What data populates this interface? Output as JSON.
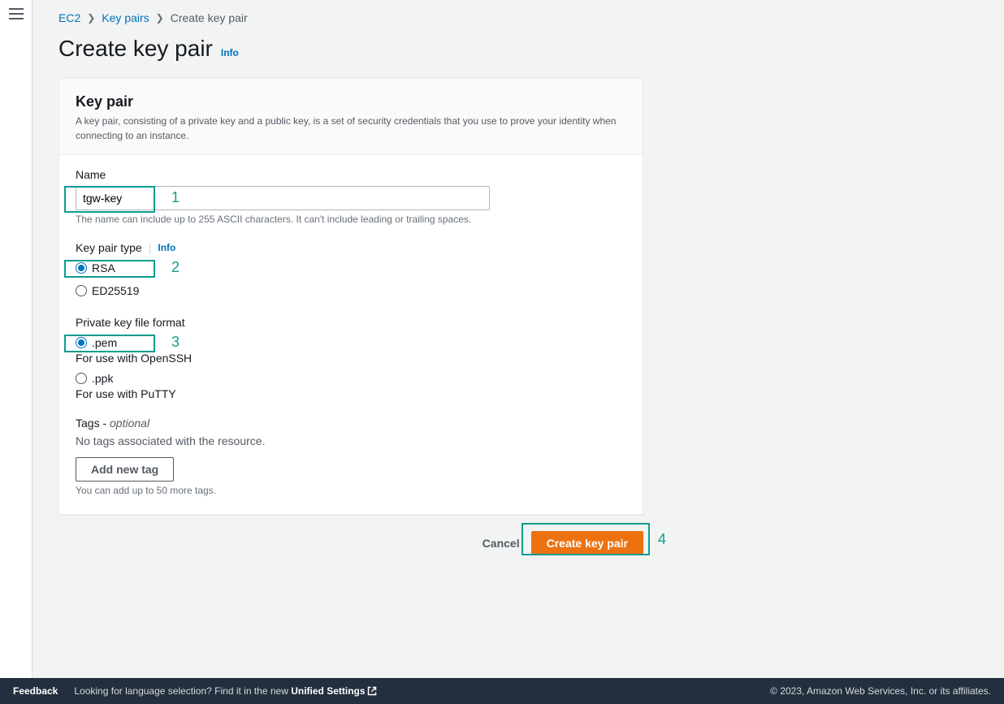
{
  "breadcrumb": {
    "ec2": "EC2",
    "keypairs": "Key pairs",
    "current": "Create key pair"
  },
  "heading": {
    "title": "Create key pair",
    "info": "Info"
  },
  "panel": {
    "title": "Key pair",
    "description": "A key pair, consisting of a private key and a public key, is a set of security credentials that you use to prove your identity when connecting to an instance."
  },
  "form": {
    "name": {
      "label": "Name",
      "value": "tgw-key",
      "help": "The name can include up to 255 ASCII characters. It can't include leading or trailing spaces."
    },
    "type": {
      "label": "Key pair type",
      "info": "Info",
      "options": {
        "rsa": "RSA",
        "ed25519": "ED25519"
      },
      "selected": "rsa"
    },
    "format": {
      "label": "Private key file format",
      "options": {
        "pem": {
          "label": ".pem",
          "sub": "For use with OpenSSH"
        },
        "ppk": {
          "label": ".ppk",
          "sub": "For use with PuTTY"
        }
      },
      "selected": "pem"
    },
    "tags": {
      "label_prefix": "Tags - ",
      "label_suffix": "optional",
      "empty": "No tags associated with the resource.",
      "add_button": "Add new tag",
      "help": "You can add up to 50 more tags."
    }
  },
  "actions": {
    "cancel": "Cancel",
    "create": "Create key pair"
  },
  "annotations": {
    "n1": "1",
    "n2": "2",
    "n3": "3",
    "n4": "4"
  },
  "footer": {
    "feedback": "Feedback",
    "lang_prefix": "Looking for language selection? Find it in the new ",
    "lang_link": "Unified Settings",
    "copyright": "© 2023, Amazon Web Services, Inc. or its affiliates."
  }
}
